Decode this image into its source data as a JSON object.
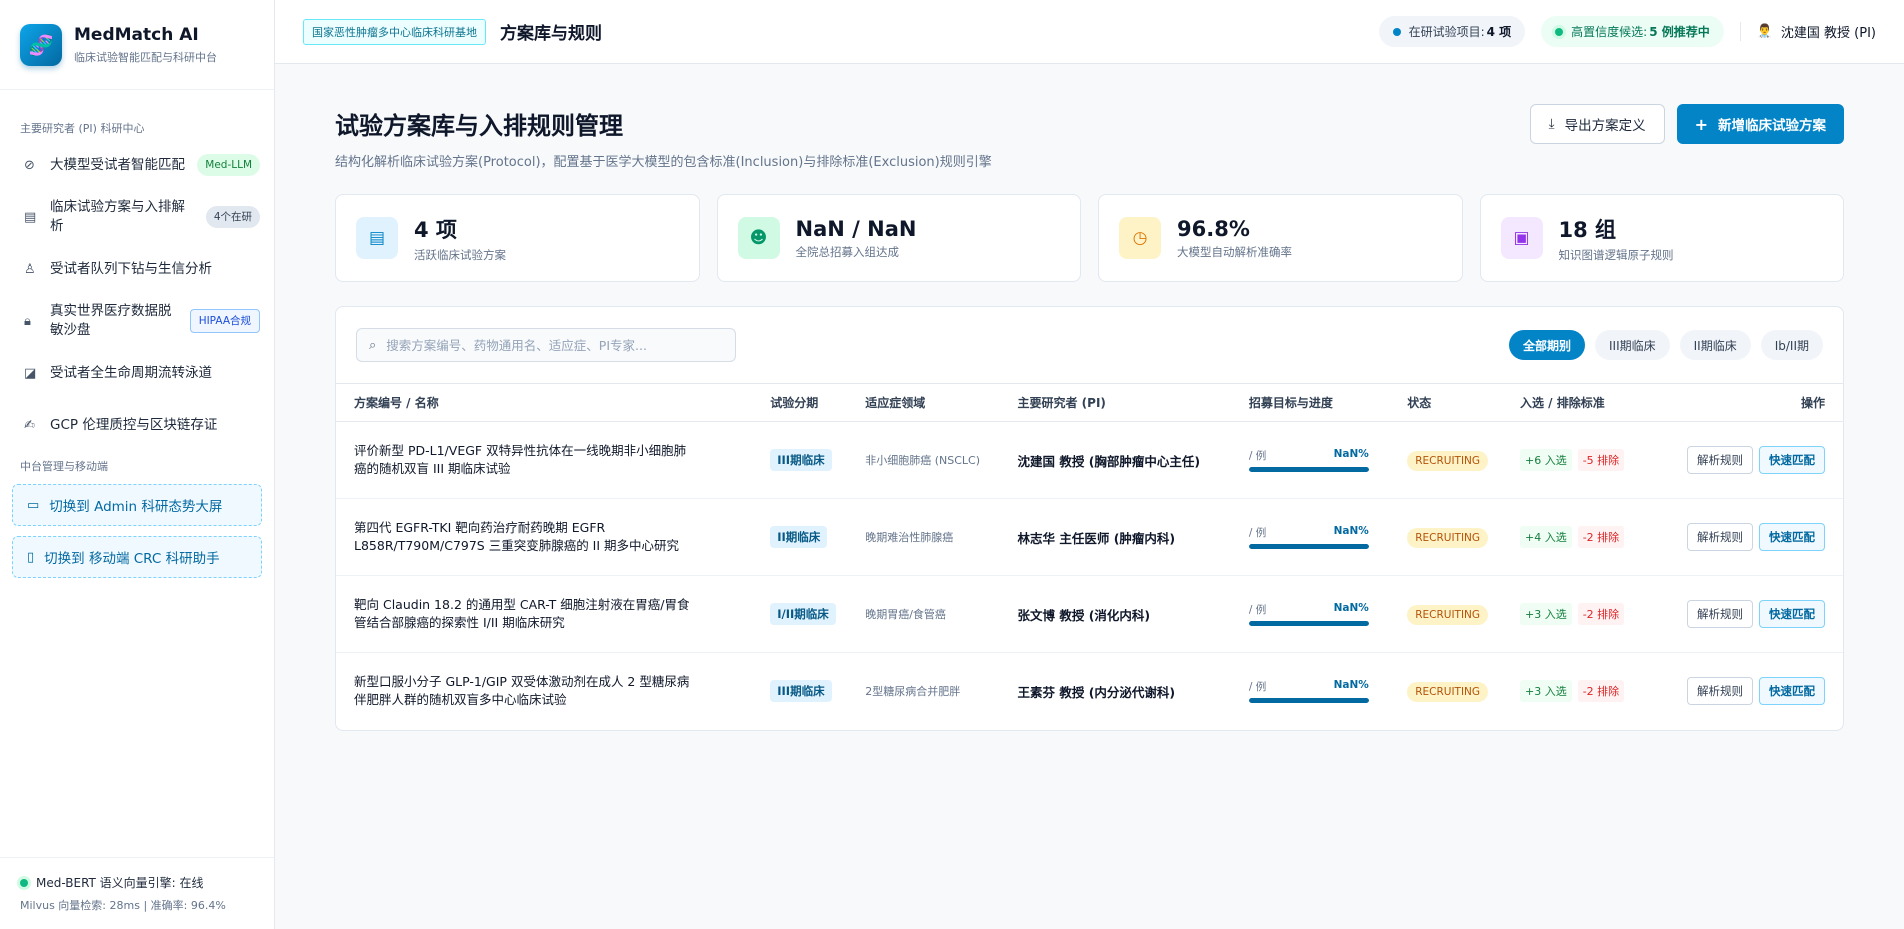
{
  "brand": {
    "title": "MedMatch AI",
    "subtitle": "临床试验智能匹配与科研中台"
  },
  "sidebar": {
    "section1": "主要研究者 (PI) 科研中心",
    "items": [
      {
        "label": "大模型受试者智能匹配",
        "badge": "Med-LLM",
        "icon": "compass-icon"
      },
      {
        "label": "临床试验方案与入排解析",
        "badge": "4个在研",
        "icon": "document-icon"
      },
      {
        "label": "受试者队列下钻与生信分析",
        "badge": "",
        "icon": "user-icon"
      },
      {
        "label": "真实世界医疗数据脱敏沙盘",
        "badge": "HIPAA合规",
        "icon": "lock-icon"
      },
      {
        "label": "受试者全生命周期流转泳道",
        "badge": "",
        "icon": "chart-icon"
      },
      {
        "label": "GCP 伦理质控与区块链存证",
        "badge": "",
        "icon": "signature-icon"
      }
    ],
    "section2": "中台管理与移动端",
    "switch_admin": "切换到 Admin 科研态势大屏",
    "switch_crc": "切换到 移动端 CRC 科研助手",
    "footer_engine": "Med-BERT 语义向量引擎: 在线",
    "footer_stats": "Milvus 向量检索: 28ms | 准确率: 96.4%"
  },
  "topbar": {
    "org_tag": "国家恶性肿瘤多中心临床科研基地",
    "title": "方案库与规则",
    "pill1_label": "在研试验项目:",
    "pill1_value": "4 项",
    "pill2_label": "高置信度候选:",
    "pill2_value": "5 例推荐中",
    "user": "沈建国 教授 (PI)"
  },
  "page": {
    "title": "试验方案库与入排规则管理",
    "desc": "结构化解析临床试验方案(Protocol)，配置基于医学大模型的包含标准(Inclusion)与排除标准(Exclusion)规则引擎",
    "export_label": "导出方案定义",
    "new_label": "新增临床试验方案"
  },
  "stats": [
    {
      "value": "4 项",
      "label": "活跃临床试验方案",
      "color": "#0284c7",
      "bg": "#e0f2fe",
      "icon": "document-icon"
    },
    {
      "value": "NaN / NaN",
      "label": "全院总招募入组达成",
      "color": "#059669",
      "bg": "#d1fae5",
      "icon": "users-icon"
    },
    {
      "value": "96.8%",
      "label": "大模型自动解析准确率",
      "color": "#d97706",
      "bg": "#fef3c7",
      "icon": "clock-icon"
    },
    {
      "value": "18 组",
      "label": "知识图谱逻辑原子规则",
      "color": "#9333ea",
      "bg": "#f3e8ff",
      "icon": "chip-icon"
    }
  ],
  "search": {
    "placeholder": "搜索方案编号、药物通用名、适应症、PI专家..."
  },
  "filters": [
    "全部期别",
    "III期临床",
    "II期临床",
    "Ib/II期"
  ],
  "table": {
    "headers": [
      "方案编号 / 名称",
      "试验分期",
      "适应症领域",
      "主要研究者 (PI)",
      "招募目标与进度",
      "状态",
      "入选 / 排除标准",
      "操作"
    ],
    "rows": [
      {
        "name": "评价新型 PD-L1/VEGF 双特异性抗体在一线晚期非小细胞肺癌的随机双盲 III 期临床试验",
        "phase": "III期临床",
        "indication": "非小细胞肺癌 (NSCLC)",
        "pi": "沈建国 教授 (胸部肿瘤中心主任)",
        "target": "/ 例",
        "pct": "NaN%",
        "progress": 1.0,
        "status": "RECRUITING",
        "inc": "+6 入选",
        "exc": "-5 排除"
      },
      {
        "name": "第四代 EGFR-TKI 靶向药治疗耐药晚期 EGFR L858R/T790M/C797S 三重突变肺腺癌的 II 期多中心研究",
        "phase": "II期临床",
        "indication": "晚期难治性肺腺癌",
        "pi": "林志华 主任医师 (肿瘤内科)",
        "target": "/ 例",
        "pct": "NaN%",
        "progress": 1.0,
        "status": "RECRUITING",
        "inc": "+4 入选",
        "exc": "-2 排除"
      },
      {
        "name": "靶向 Claudin 18.2 的通用型 CAR-T 细胞注射液在胃癌/胃食管结合部腺癌的探索性 I/II 期临床研究",
        "phase": "I/II期临床",
        "indication": "晚期胃癌/食管癌",
        "pi": "张文博 教授 (消化内科)",
        "target": "/ 例",
        "pct": "NaN%",
        "progress": 1.0,
        "status": "RECRUITING",
        "inc": "+3 入选",
        "exc": "-2 排除"
      },
      {
        "name": "新型口服小分子 GLP-1/GIP 双受体激动剂在成人 2 型糖尿病伴肥胖人群的随机双盲多中心临床试验",
        "phase": "III期临床",
        "indication": "2型糖尿病合并肥胖",
        "pi": "王素芬 教授 (内分泌代谢科)",
        "target": "/ 例",
        "pct": "NaN%",
        "progress": 1.0,
        "status": "RECRUITING",
        "inc": "+3 入选",
        "exc": "-2 排除"
      }
    ],
    "op_parse": "解析规则",
    "op_match": "快速匹配"
  }
}
